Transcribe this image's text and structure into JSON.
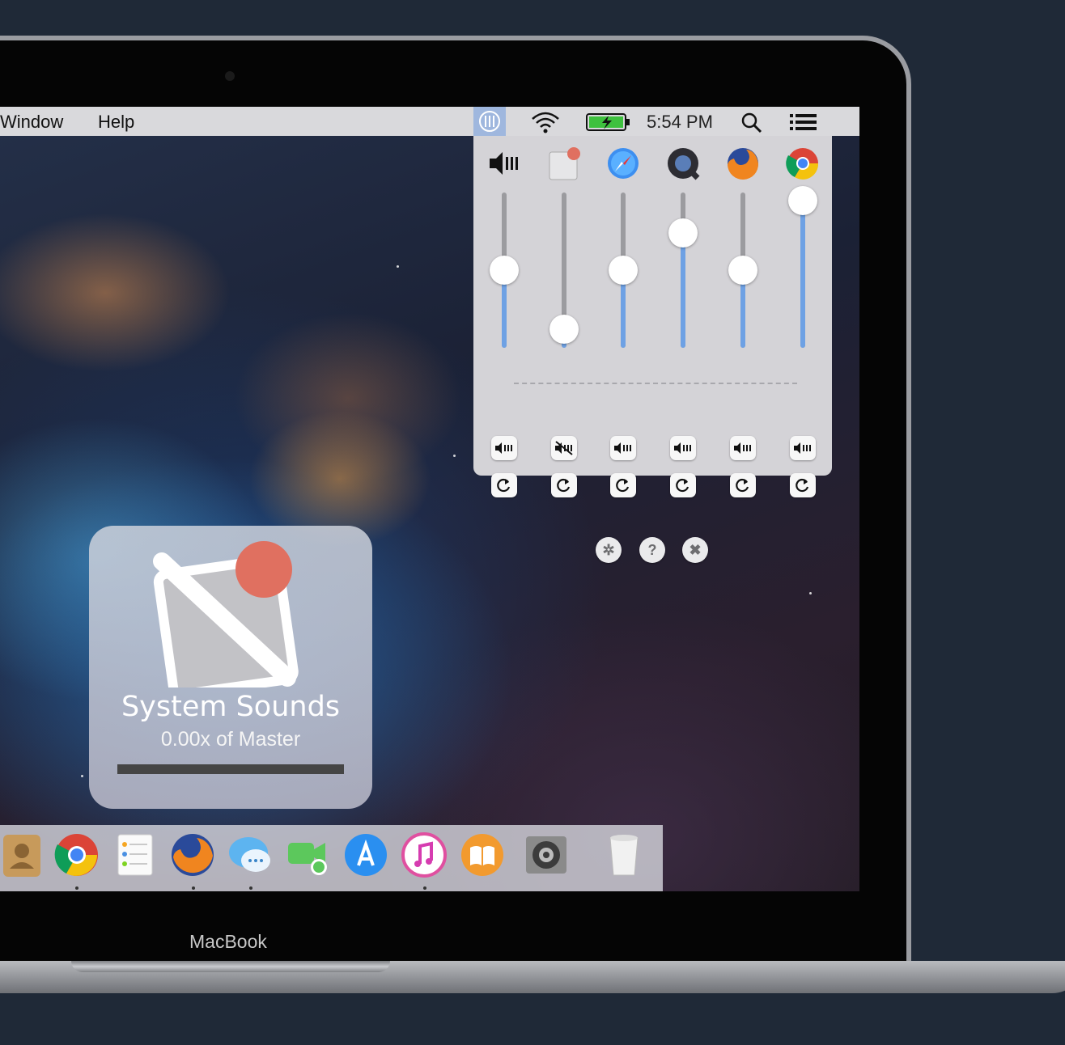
{
  "menubar": {
    "items": [
      "Window",
      "Help"
    ],
    "clock": "5:54 PM",
    "icons": [
      "mixer-menubar-icon",
      "wifi-icon",
      "battery-icon",
      "search-icon",
      "list-icon"
    ]
  },
  "mixer": {
    "channels": [
      {
        "name": "Master",
        "icon": "speaker-icon",
        "level": 0.5,
        "muted": false
      },
      {
        "name": "System Sounds",
        "icon": "system-sounds-icon",
        "level": 0.12,
        "muted": true
      },
      {
        "name": "Safari",
        "icon": "safari-icon",
        "level": 0.5,
        "muted": false
      },
      {
        "name": "QuickTime",
        "icon": "quicktime-icon",
        "level": 0.74,
        "muted": false
      },
      {
        "name": "Firefox",
        "icon": "firefox-icon",
        "level": 0.5,
        "muted": false
      },
      {
        "name": "Chrome",
        "icon": "chrome-icon",
        "level": 0.95,
        "muted": false
      }
    ],
    "footer_buttons": [
      "settings-icon",
      "help-icon",
      "close-icon"
    ],
    "help_glyph": "?",
    "close_glyph": "✖",
    "settings_glyph": "✲",
    "accent_color": "#6ea1e4"
  },
  "hud": {
    "title": "System Sounds",
    "subtitle": "0.00x of Master",
    "level": 1.0,
    "badge_color": "#e07060"
  },
  "dock": {
    "apps": [
      "Contacts",
      "Chrome",
      "Reminders",
      "Firefox",
      "Messages",
      "FaceTime",
      "App Store",
      "iTunes",
      "iBooks",
      "System Preferences",
      "Trash"
    ]
  },
  "device": {
    "label": "MacBook"
  }
}
